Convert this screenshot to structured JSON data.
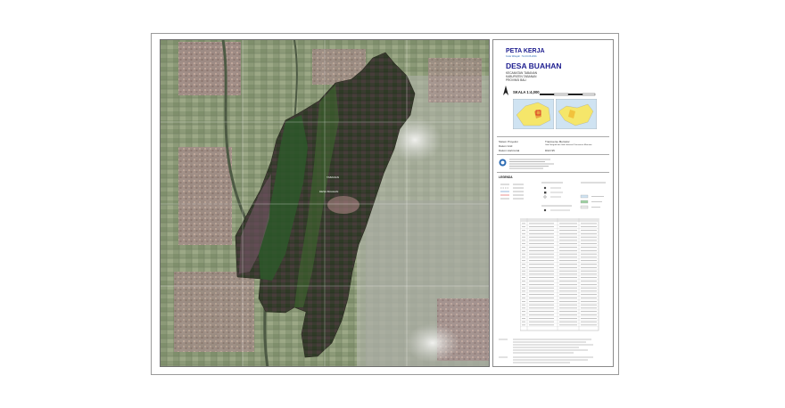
{
  "header": {
    "peta_kerja": "PETA KERJA",
    "kode_wilayah": "Kode Wilayah : 51.03.06.2001",
    "desa": "DESA BUAHAN",
    "kecamatan": "KECAMATAN TABANAN",
    "kabupaten": "KABUPATEN TABANAN",
    "provinsi": "PROVINSI BALI",
    "skala": "SKALA 1:4,000"
  },
  "info": {
    "sistem_proyeksi_label": "Sistem Proyeksi",
    "sistem_proyeksi_value": "Transverse Mercator",
    "datum_grid_label": "Datum Grid",
    "datum_grid_value": "Grid Geografi dan Grid Universal Transverse Mercator",
    "datum_horizontal_label": "Datum Horizontal",
    "datum_horizontal_value": "DGN 95"
  },
  "map_labels": {
    "village_label": "DESA BUAHAN",
    "small_label": "TABANAN"
  },
  "legend": {
    "title": "LEGENDA"
  },
  "colors": {
    "title_blue": "#1d1d8f",
    "accent_blue": "#2c6bb3",
    "inset_yellow": "#f5e66a",
    "inset_red": "#d62020"
  }
}
